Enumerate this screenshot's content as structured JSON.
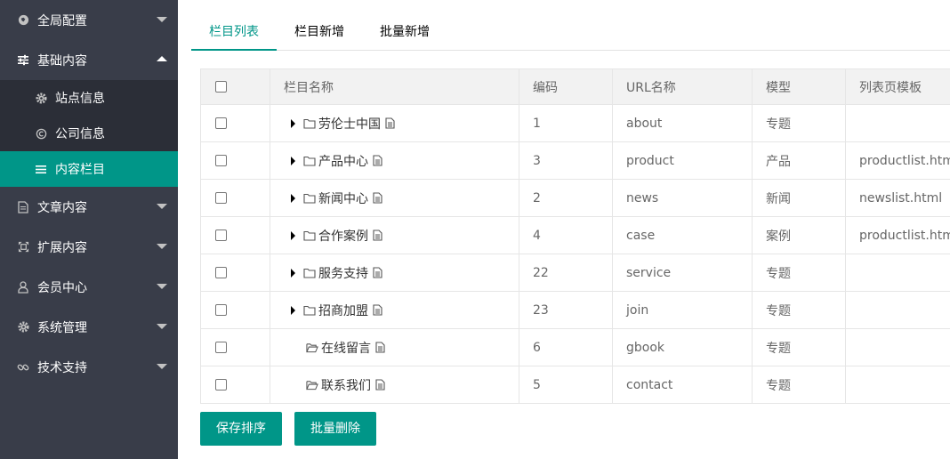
{
  "sidebar": {
    "items": [
      {
        "label": "全局配置",
        "icon": "globe-icon",
        "expanded": false
      },
      {
        "label": "基础内容",
        "icon": "sliders-icon",
        "expanded": true,
        "children": [
          {
            "label": "站点信息",
            "icon": "gear-icon"
          },
          {
            "label": "公司信息",
            "icon": "copyright-icon"
          },
          {
            "label": "内容栏目",
            "icon": "list-icon",
            "active": true
          }
        ]
      },
      {
        "label": "文章内容",
        "icon": "file-icon",
        "expanded": false
      },
      {
        "label": "扩展内容",
        "icon": "expand-icon",
        "expanded": false
      },
      {
        "label": "会员中心",
        "icon": "user-icon",
        "expanded": false
      },
      {
        "label": "系统管理",
        "icon": "gear-icon",
        "expanded": false
      },
      {
        "label": "技术支持",
        "icon": "link-icon",
        "expanded": false
      }
    ]
  },
  "tabs": [
    "栏目列表",
    "栏目新增",
    "批量新增"
  ],
  "table": {
    "headers": [
      "栏目名称",
      "编码",
      "URL名称",
      "模型",
      "列表页模板"
    ],
    "rows": [
      {
        "name": "劳伦士中国",
        "has_children": true,
        "code": "1",
        "url": "about",
        "model": "专题",
        "template": ""
      },
      {
        "name": "产品中心",
        "has_children": true,
        "code": "3",
        "url": "product",
        "model": "产品",
        "template": "productlist.html"
      },
      {
        "name": "新闻中心",
        "has_children": true,
        "code": "2",
        "url": "news",
        "model": "新闻",
        "template": "newslist.html"
      },
      {
        "name": "合作案例",
        "has_children": true,
        "code": "4",
        "url": "case",
        "model": "案例",
        "template": "productlist.html"
      },
      {
        "name": "服务支持",
        "has_children": true,
        "code": "22",
        "url": "service",
        "model": "专题",
        "template": ""
      },
      {
        "name": "招商加盟",
        "has_children": true,
        "code": "23",
        "url": "join",
        "model": "专题",
        "template": ""
      },
      {
        "name": "在线留言",
        "has_children": false,
        "code": "6",
        "url": "gbook",
        "model": "专题",
        "template": ""
      },
      {
        "name": "联系我们",
        "has_children": false,
        "code": "5",
        "url": "contact",
        "model": "专题",
        "template": ""
      }
    ]
  },
  "buttons": {
    "save_sort": "保存排序",
    "batch_delete": "批量删除"
  },
  "colors": {
    "accent": "#009688",
    "sidebar_bg": "#393d49",
    "submenu_bg": "#2b2e37"
  }
}
